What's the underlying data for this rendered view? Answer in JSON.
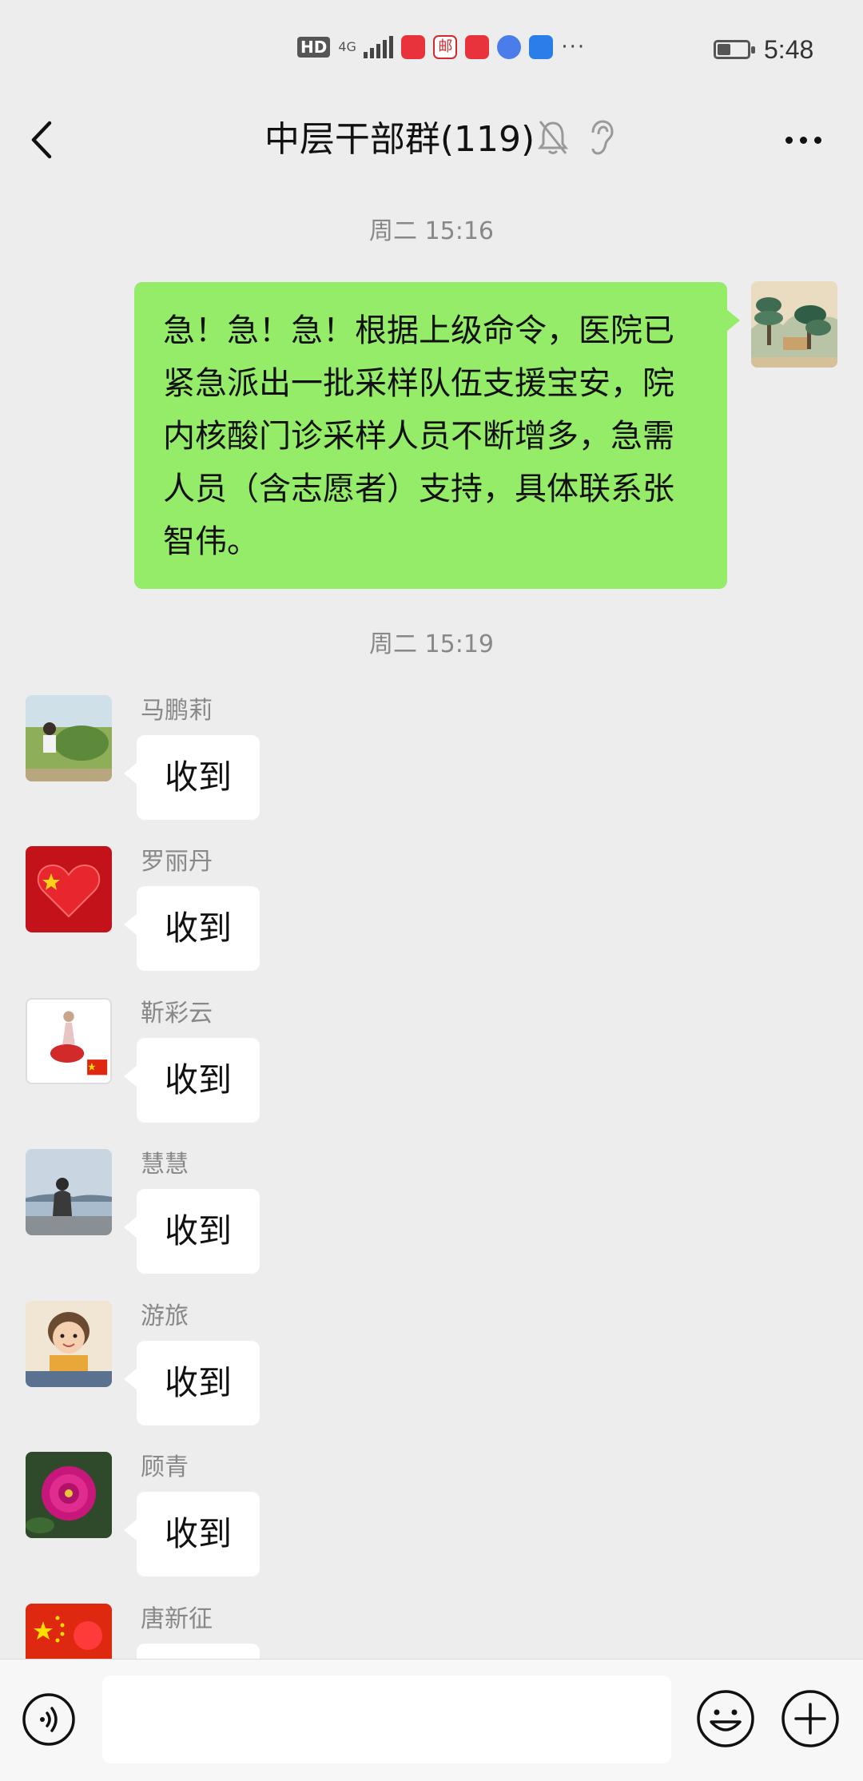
{
  "status_bar": {
    "hd": "HD",
    "network": "4G",
    "time": "5:48",
    "more": "···",
    "battery_level": 0.45,
    "app_icons": [
      "red-app-icon",
      "mail-app-icon",
      "red-book-icon",
      "music-icon",
      "blue-app-icon"
    ]
  },
  "nav": {
    "title": "中层干部群(119)",
    "icons": [
      "back-icon",
      "mute-bell-icon",
      "ear-icon",
      "more-icon"
    ]
  },
  "chat": {
    "timestamp_1": "周二 15:16",
    "my_message": "急！急！急！根据上级命令，医院已紧急派出一批采样队伍支援宝安，院内核酸门诊采样人员不断增多，急需人员（含志愿者）支持，具体联系张智伟。",
    "timestamp_2": "周二 15:19",
    "messages": [
      {
        "sender": "马鹏莉",
        "text": "收到"
      },
      {
        "sender": "罗丽丹",
        "text": "收到"
      },
      {
        "sender": "靳彩云",
        "text": "收到"
      },
      {
        "sender": "慧慧",
        "text": "收到"
      },
      {
        "sender": "游旅",
        "text": "收到"
      },
      {
        "sender": "顾青",
        "text": "收到"
      },
      {
        "sender": "唐新征",
        "text": ""
      }
    ]
  },
  "input": {
    "placeholder": ""
  },
  "colors": {
    "background": "#ededed",
    "my_bubble": "#95ec69",
    "other_bubble": "#ffffff",
    "meta_text": "#888888"
  }
}
